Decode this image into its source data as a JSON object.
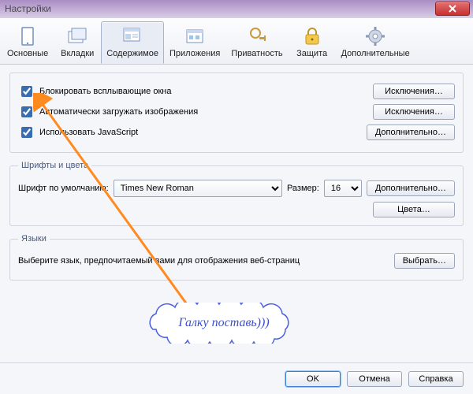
{
  "window": {
    "title": "Настройки"
  },
  "toolbar": {
    "items": [
      {
        "id": "general",
        "label": "Основные"
      },
      {
        "id": "tabs",
        "label": "Вкладки"
      },
      {
        "id": "content",
        "label": "Содержимое"
      },
      {
        "id": "apps",
        "label": "Приложения"
      },
      {
        "id": "privacy",
        "label": "Приватность"
      },
      {
        "id": "security",
        "label": "Защита"
      },
      {
        "id": "advanced",
        "label": "Дополнительные"
      }
    ],
    "active": "content"
  },
  "content_group": {
    "popups": {
      "label": "Блокировать всплывающие окна",
      "checked": true
    },
    "images": {
      "label": "Автоматически загружать изображения",
      "checked": true
    },
    "js": {
      "label": "Использовать JavaScript",
      "checked": true
    },
    "btn_exceptions": "Исключения…",
    "btn_extra": "Дополнительно…"
  },
  "fonts_group": {
    "legend": "Шрифты и цвета",
    "default_font_label": "Шрифт по умолчанию:",
    "default_font": "Times New Roman",
    "size_label": "Размер:",
    "size": "16",
    "btn_extra": "Дополнительно…",
    "btn_colors": "Цвета…"
  },
  "lang_group": {
    "legend": "Языки",
    "text": "Выберите язык, предпочитаемый вами для отображения веб-страниц",
    "btn": "Выбрать…"
  },
  "bottom": {
    "ok": "OK",
    "cancel": "Отмена",
    "help": "Справка"
  },
  "callout": {
    "text": "Галку поставь)))"
  }
}
